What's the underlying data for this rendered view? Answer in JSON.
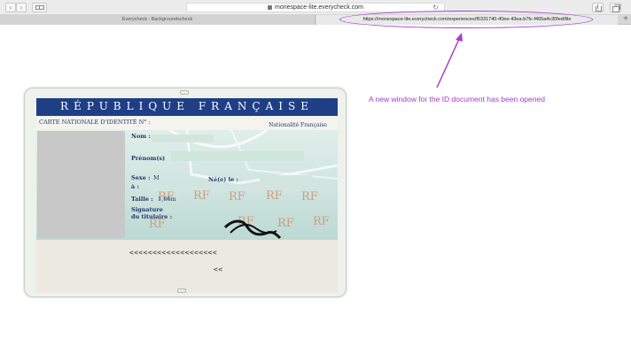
{
  "browser": {
    "url_short": "monespace-lite.everycheck.com",
    "tabs": [
      {
        "label": "Everycheck : Backgroundscheck"
      },
      {
        "label": "https://monespace-lite.everycheck.com/experiences/f6331740-40ee-43ea-b7fc-f465a4c30fed/file"
      }
    ]
  },
  "annotation": {
    "text": "A new window for the ID document has been opened",
    "color": "#a63cc9"
  },
  "id_card": {
    "header": "RÉPUBLIQUE FRANÇAISE",
    "card_type": "CARTE NATIONALE D'IDENTITÉ N° :",
    "nationality": "Nationalité Française",
    "labels": {
      "nom": "Nom :",
      "prenoms": "Prénom(s)",
      "sexe": "Sexe :",
      "sexe_value": "M",
      "ne_le": "Né(e) le :",
      "a": "à :",
      "taille": "Taille :",
      "taille_value": "1,86m",
      "signature_line1": "Signature",
      "signature_line2": "du titulaire :"
    },
    "mrz_line1": "<<<<<<<<<<<<<<<<<<<",
    "mrz_line2": "<<",
    "colors": {
      "header_bg": "#1e3f86",
      "label": "#21386a"
    }
  }
}
